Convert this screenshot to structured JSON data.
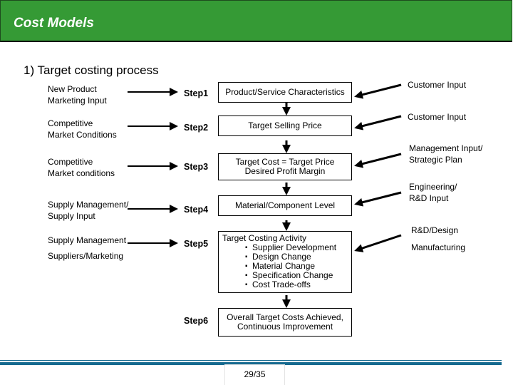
{
  "header": {
    "title": "Cost Models",
    "color": "#359a35"
  },
  "subtitle": "1) Target costing process",
  "inputs_left": [
    {
      "lines": [
        "New Product",
        "Marketing Input"
      ]
    },
    {
      "lines": [
        "Competitive",
        "Market Conditions"
      ]
    },
    {
      "lines": [
        "Competitive",
        "Market conditions"
      ]
    },
    {
      "lines": [
        "Supply Management/",
        "Supply Input"
      ]
    },
    {
      "lines": [
        "Supply Management",
        "Suppliers/Marketing"
      ]
    }
  ],
  "steps": [
    {
      "label": "Step1",
      "box": [
        "Product/Service Characteristics"
      ]
    },
    {
      "label": "Step2",
      "box": [
        "Target Selling Price"
      ]
    },
    {
      "label": "Step3",
      "box": [
        "Target Cost = Target Price",
        "Desired Profit Margin"
      ]
    },
    {
      "label": "Step4",
      "box": [
        "Material/Component Level"
      ]
    },
    {
      "label": "Step5",
      "box_title": "Target Costing Activity",
      "bullets": [
        "Supplier Development",
        "Design Change",
        "Material Change",
        "Specification Change",
        "Cost Trade-offs"
      ]
    },
    {
      "label": "Step6",
      "box": [
        "Overall Target Costs Achieved,",
        "Continuous Improvement"
      ]
    }
  ],
  "inputs_right": [
    {
      "lines": [
        "Customer Input"
      ]
    },
    {
      "lines": [
        "Customer Input"
      ]
    },
    {
      "lines": [
        "Management Input/",
        "Strategic Plan"
      ]
    },
    {
      "lines": [
        "Engineering/",
        "R&D Input"
      ]
    },
    {
      "lines": [
        "R&D/Design"
      ]
    },
    {
      "lines": [
        "Manufacturing"
      ]
    }
  ],
  "footer": {
    "page": "29/35",
    "line_color": "#166a8f"
  }
}
